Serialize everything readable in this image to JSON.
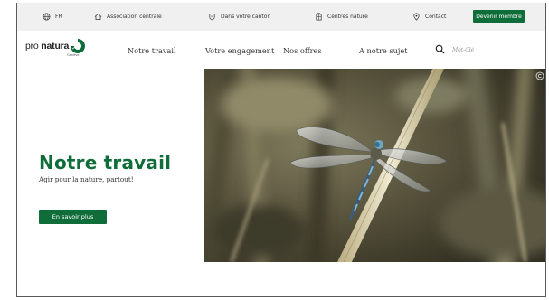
{
  "topbar": {
    "language": "FR",
    "association": "Association centrale",
    "canton": "Dans votre canton",
    "centres": "Centres nature",
    "contact": "Contact",
    "cta": "Devenir membre"
  },
  "logo": {
    "name_light": "pro ",
    "name_bold": "natura",
    "subtitle": "Genève"
  },
  "nav": {
    "items": [
      "Notre travail",
      "Votre engagement",
      "Nos offres",
      "A notre sujet"
    ]
  },
  "search": {
    "placeholder": "Mot-Clé"
  },
  "hero": {
    "title": "Notre travail",
    "subtitle": "Agir pour la nature, partout!",
    "button": "En savoir plus"
  },
  "colors": {
    "brand_green": "#0f6d3a",
    "topbar_bg": "#f0f0f0"
  },
  "icons": [
    "globe-icon",
    "home-icon",
    "shield-icon",
    "building-icon",
    "location-pin-icon",
    "search-icon",
    "copyright-icon"
  ]
}
